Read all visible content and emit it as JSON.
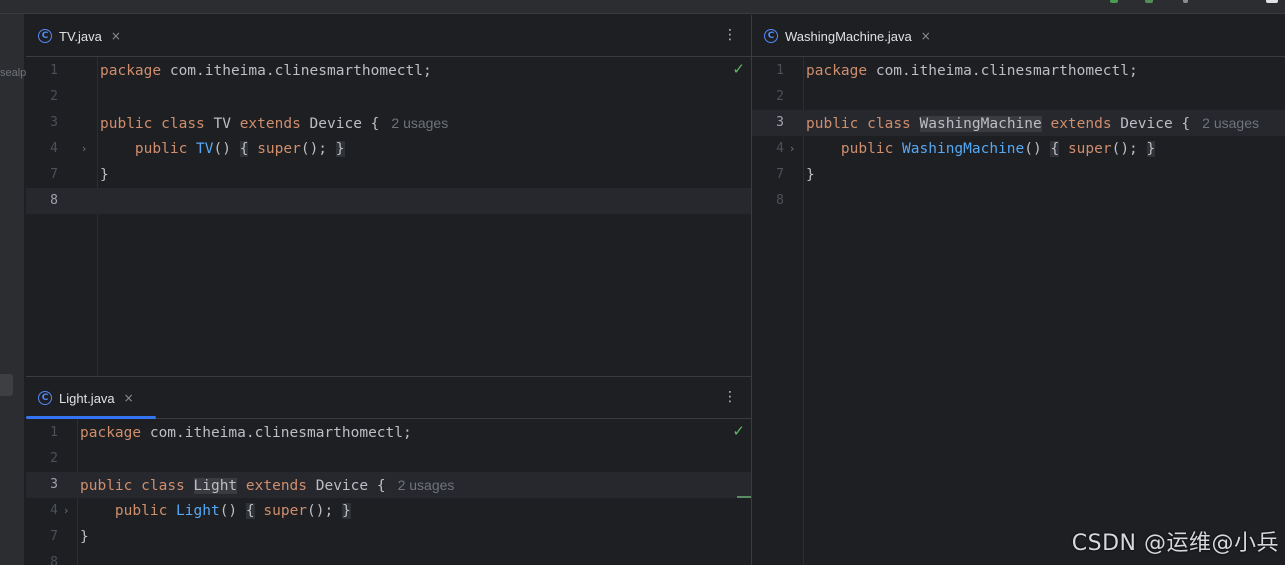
{
  "colors": {
    "accent": "#3574f0",
    "keyword": "#cf8e6d",
    "function": "#56a8f5",
    "ok": "#5fb865",
    "background": "#1e1f22"
  },
  "left_rail": {
    "fragment": "sealp"
  },
  "editors": {
    "top_left": {
      "tab": {
        "label": "TV.java",
        "icon": "class-icon",
        "icon_glyph": "C",
        "close": "×"
      },
      "menu": "⋮",
      "status_icon": "check-icon",
      "status_glyph": "✓",
      "lines": [
        {
          "n": "1",
          "tokens": [
            [
              "kw",
              "package"
            ],
            [
              "p",
              " com.itheima.clinesmarthomectl;"
            ]
          ]
        },
        {
          "n": "2",
          "tokens": []
        },
        {
          "n": "3",
          "tokens": [
            [
              "kw",
              "public"
            ],
            [
              "p",
              " "
            ],
            [
              "kw",
              "class"
            ],
            [
              "p",
              " TV "
            ],
            [
              "kw",
              "extends"
            ],
            [
              "p",
              " Device {"
            ]
          ],
          "hint": "2 usages"
        },
        {
          "n": "4",
          "fold": "›",
          "tokens": [
            [
              "p",
              "    "
            ],
            [
              "kw",
              "public"
            ],
            [
              "p",
              " "
            ],
            [
              "fn",
              "TV"
            ],
            [
              "p",
              "()"
            ],
            [
              "p",
              " "
            ],
            [
              "br",
              "{"
            ],
            [
              "p",
              " "
            ],
            [
              "kw",
              "super"
            ],
            [
              "p",
              "();"
            ],
            [
              "p",
              " "
            ],
            [
              "br",
              "}"
            ]
          ]
        },
        {
          "n": "7",
          "tokens": [
            [
              "p",
              "}"
            ]
          ]
        },
        {
          "n": "8",
          "current": true,
          "tokens": []
        }
      ]
    },
    "bottom_left": {
      "tab": {
        "label": "Light.java",
        "icon": "class-icon",
        "icon_glyph": "C",
        "close": "×"
      },
      "menu": "⋮",
      "status_icon": "check-icon",
      "status_glyph": "✓",
      "lines": [
        {
          "n": "1",
          "tokens": [
            [
              "kw",
              "package"
            ],
            [
              "p",
              " com.itheima.clinesmarthomectl;"
            ]
          ]
        },
        {
          "n": "2",
          "tokens": []
        },
        {
          "n": "3",
          "current": true,
          "tokens": [
            [
              "kw",
              "public"
            ],
            [
              "p",
              " "
            ],
            [
              "kw",
              "class"
            ],
            [
              "p",
              " "
            ],
            [
              "hl",
              "Light"
            ],
            [
              "p",
              " "
            ],
            [
              "kw",
              "extends"
            ],
            [
              "p",
              " Device {"
            ]
          ],
          "hint": "2 usages"
        },
        {
          "n": "4",
          "fold": "›",
          "tokens": [
            [
              "p",
              "    "
            ],
            [
              "kw",
              "public"
            ],
            [
              "p",
              " "
            ],
            [
              "fn",
              "Light"
            ],
            [
              "p",
              "()"
            ],
            [
              "p",
              " "
            ],
            [
              "br",
              "{"
            ],
            [
              "p",
              " "
            ],
            [
              "kw",
              "super"
            ],
            [
              "p",
              "();"
            ],
            [
              "p",
              " "
            ],
            [
              "br",
              "}"
            ]
          ]
        },
        {
          "n": "7",
          "tokens": [
            [
              "p",
              "}"
            ]
          ]
        },
        {
          "n": "8",
          "tokens": []
        }
      ]
    },
    "right": {
      "tab": {
        "label": "WashingMachine.java",
        "icon": "class-icon",
        "icon_glyph": "C",
        "close": "×"
      },
      "lines": [
        {
          "n": "1",
          "tokens": [
            [
              "kw",
              "package"
            ],
            [
              "p",
              " com.itheima.clinesmarthomectl;"
            ]
          ]
        },
        {
          "n": "2",
          "tokens": []
        },
        {
          "n": "3",
          "current": true,
          "tokens": [
            [
              "kw",
              "public"
            ],
            [
              "p",
              " "
            ],
            [
              "kw",
              "class"
            ],
            [
              "p",
              " "
            ],
            [
              "hl",
              "WashingMachine"
            ],
            [
              "p",
              " "
            ],
            [
              "kw",
              "extends"
            ],
            [
              "p",
              " Device {"
            ]
          ],
          "hint": "2 usages"
        },
        {
          "n": "4",
          "fold": "›",
          "tokens": [
            [
              "p",
              "    "
            ],
            [
              "kw",
              "public"
            ],
            [
              "p",
              " "
            ],
            [
              "fn",
              "WashingMachine"
            ],
            [
              "p",
              "()"
            ],
            [
              "p",
              " "
            ],
            [
              "br",
              "{"
            ],
            [
              "p",
              " "
            ],
            [
              "kw",
              "super"
            ],
            [
              "p",
              "();"
            ],
            [
              "p",
              " "
            ],
            [
              "br",
              "}"
            ]
          ]
        },
        {
          "n": "7",
          "tokens": [
            [
              "p",
              "}"
            ]
          ]
        },
        {
          "n": "8",
          "tokens": []
        }
      ]
    }
  },
  "watermark": "CSDN @运维@小兵"
}
